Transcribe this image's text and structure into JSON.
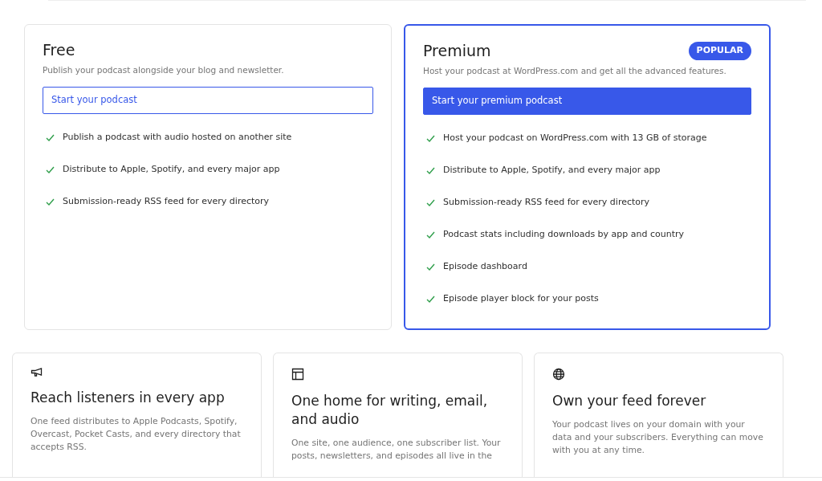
{
  "plans": [
    {
      "name": "Free",
      "description": "Publish your podcast alongside your blog and newsletter.",
      "featured": false,
      "button": {
        "label": "Start your podcast"
      },
      "features": [
        "Publish a podcast with audio hosted on another site",
        "Distribute to Apple, Spotify, and every major app",
        "Submission-ready RSS feed for every directory"
      ]
    },
    {
      "name": "Premium",
      "badge": "POPULAR",
      "description": "Host your podcast at WordPress.com and get all the advanced features.",
      "featured": true,
      "button": {
        "label": "Start your premium podcast"
      },
      "features": [
        "Host your podcast on WordPress.com with 13 GB of storage",
        "Distribute to Apple, Spotify, and every major app",
        "Submission-ready RSS feed for every directory",
        "Podcast stats including downloads by app and country",
        "Episode dashboard",
        "Episode player block for your posts"
      ]
    }
  ],
  "highlights": [
    {
      "kind": "megaphone",
      "title": "Reach listeners in every app",
      "text": "One feed distributes to Apple Podcasts, Spotify, Overcast, Pocket Casts, and every directory that accepts RSS."
    },
    {
      "kind": "layout",
      "title": "One home for writing, email, and audio",
      "text": "One site, one audience, one subscriber list. Your posts, newsletters, and episodes all live in the"
    },
    {
      "kind": "globe",
      "title": "Own your feed forever",
      "text": "Your podcast lives on your domain with your data and your subscribers. Everything can move with you at any time."
    }
  ]
}
